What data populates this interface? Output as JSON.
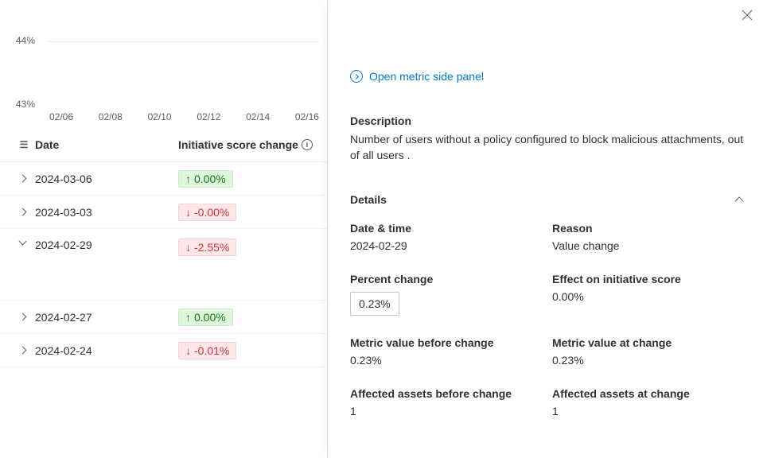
{
  "chart_data": {
    "type": "line",
    "y_ticks": [
      "44%",
      "43%"
    ],
    "x_ticks": [
      "02/06",
      "02/08",
      "02/10",
      "02/12",
      "02/14",
      "02/16"
    ]
  },
  "table": {
    "headers": {
      "date": "Date",
      "score_change": "Initiative score change"
    },
    "rows": [
      {
        "date": "2024-03-06",
        "change": "0.00%",
        "dir": "up",
        "expanded": false
      },
      {
        "date": "2024-03-03",
        "change": "-0.00%",
        "dir": "down",
        "expanded": false
      },
      {
        "date": "2024-02-29",
        "change": "-2.55%",
        "dir": "down",
        "expanded": true
      },
      {
        "date": "2024-02-27",
        "change": "0.00%",
        "dir": "up",
        "expanded": false
      },
      {
        "date": "2024-02-24",
        "change": "-0.01%",
        "dir": "down",
        "expanded": false
      }
    ]
  },
  "panel": {
    "open_link": "Open metric side panel",
    "description_label": "Description",
    "description": "Number of users without a policy configured to block malicious attachments, out of all users .",
    "details_label": "Details",
    "fields": {
      "date_time": {
        "label": "Date & time",
        "value": "2024-02-29"
      },
      "reason": {
        "label": "Reason",
        "value": "Value change"
      },
      "percent_change": {
        "label": "Percent change",
        "value": "0.23%"
      },
      "effect": {
        "label": "Effect on initiative score",
        "value": "0.00%"
      },
      "before_val": {
        "label": "Metric value before change",
        "value": "0.23%"
      },
      "at_val": {
        "label": "Metric value at change",
        "value": "0.23%"
      },
      "before_assets": {
        "label": "Affected assets before change",
        "value": "1"
      },
      "at_assets": {
        "label": "Affected assets at change",
        "value": "1"
      }
    }
  }
}
